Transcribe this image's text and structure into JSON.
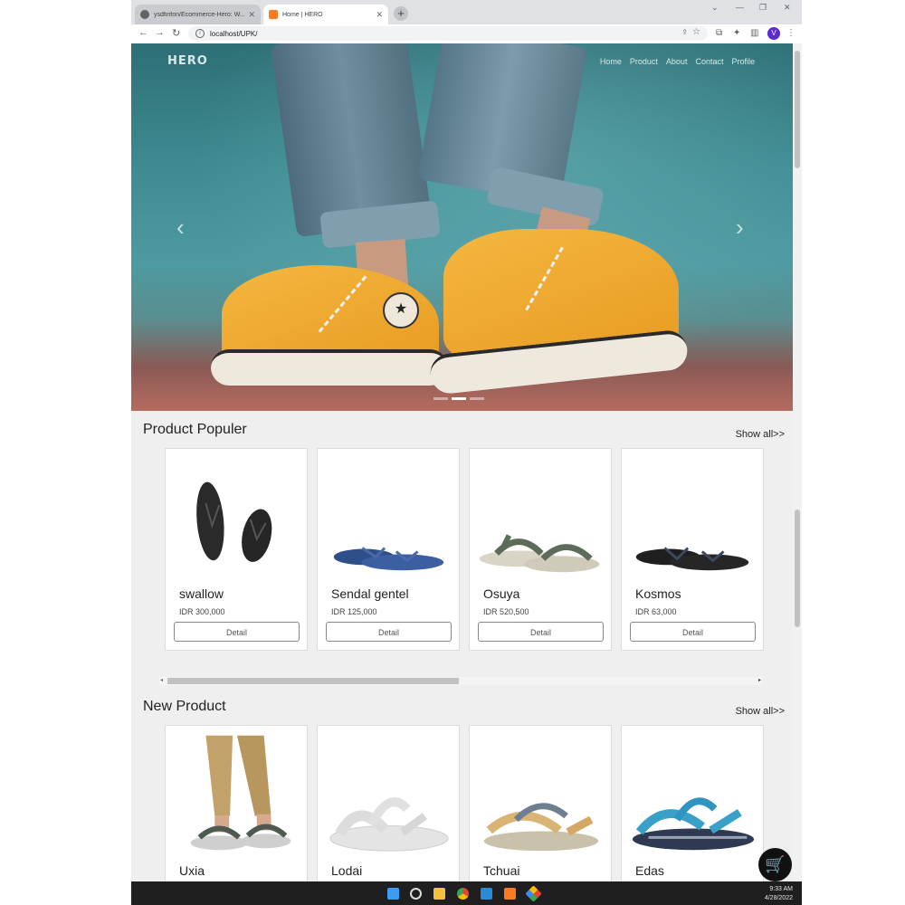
{
  "browser": {
    "tabs": [
      {
        "title": "ysdfinfon/Ecommerce-Hero: W..."
      },
      {
        "title": "Home | HERO"
      }
    ],
    "url": "localhost/UPK/",
    "profile_initial": "V"
  },
  "site": {
    "logo": "HERO",
    "nav": [
      "Home",
      "Product",
      "About",
      "Contact",
      "Profile"
    ]
  },
  "popular": {
    "title": "Product Populer",
    "show_all": "Show all>>",
    "products": [
      {
        "name": "swallow",
        "price": "IDR 300,000",
        "button": "Detail"
      },
      {
        "name": "Sendal gentel",
        "price": "IDR 125,000",
        "button": "Detail"
      },
      {
        "name": "Osuya",
        "price": "IDR 520,500",
        "button": "Detail"
      },
      {
        "name": "Kosmos",
        "price": "IDR 63,000",
        "button": "Detail"
      }
    ]
  },
  "new_products": {
    "title": "New Product",
    "show_all": "Show all>>",
    "products": [
      {
        "name": "Uxia"
      },
      {
        "name": "Lodai"
      },
      {
        "name": "Tchuai"
      },
      {
        "name": "Edas"
      }
    ]
  },
  "taskbar": {
    "time": "9:33 AM",
    "date": "4/28/2022"
  }
}
